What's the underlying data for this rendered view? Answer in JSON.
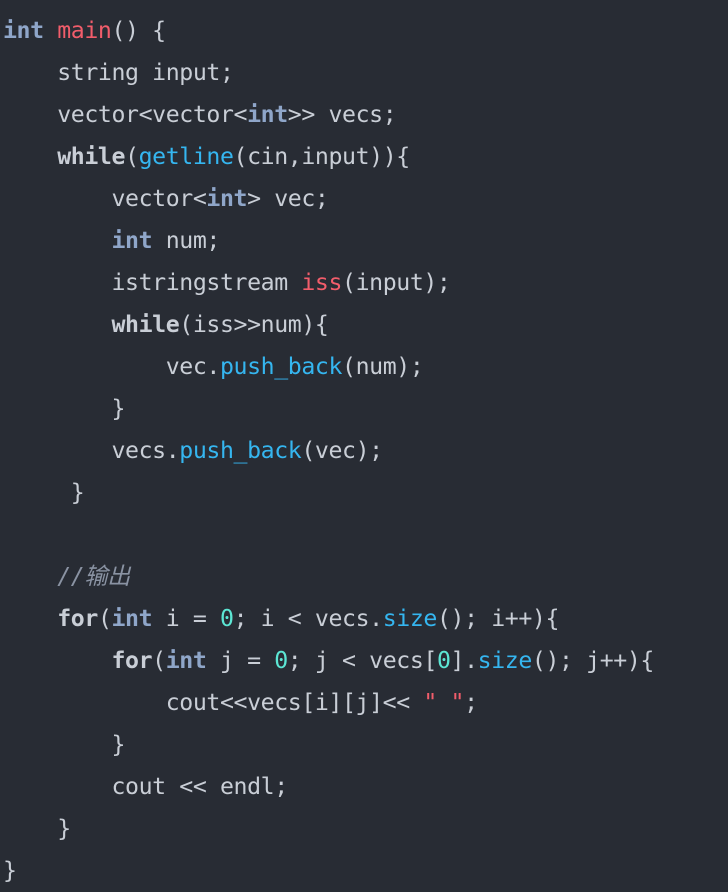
{
  "colors": {
    "background": "#282c34",
    "text": "#c9ced6",
    "type_keyword": "#8fa6c9",
    "function_name": "#f25d6b",
    "function_call": "#35b6f0",
    "number": "#5ce6d4",
    "string": "#f25d6b",
    "comment": "#8a93a3"
  },
  "code": {
    "lines": [
      [
        {
          "t": "int",
          "c": "kw-type"
        },
        {
          "t": " ",
          "c": "plain"
        },
        {
          "t": "main",
          "c": "fn-def"
        },
        {
          "t": "() {",
          "c": "plain"
        }
      ],
      [
        {
          "t": "    string input;",
          "c": "plain"
        }
      ],
      [
        {
          "t": "    vector<vector<",
          "c": "plain"
        },
        {
          "t": "int",
          "c": "kw-type"
        },
        {
          "t": ">> vecs;",
          "c": "plain"
        }
      ],
      [
        {
          "t": "    ",
          "c": "plain"
        },
        {
          "t": "while",
          "c": "kw-ctrl"
        },
        {
          "t": "(",
          "c": "plain"
        },
        {
          "t": "getline",
          "c": "fn-call"
        },
        {
          "t": "(cin,input)){",
          "c": "plain"
        }
      ],
      [
        {
          "t": "        vector<",
          "c": "plain"
        },
        {
          "t": "int",
          "c": "kw-type"
        },
        {
          "t": "> vec;",
          "c": "plain"
        }
      ],
      [
        {
          "t": "        ",
          "c": "plain"
        },
        {
          "t": "int",
          "c": "kw-type"
        },
        {
          "t": " num;",
          "c": "plain"
        }
      ],
      [
        {
          "t": "        istringstream ",
          "c": "plain"
        },
        {
          "t": "iss",
          "c": "fn-def"
        },
        {
          "t": "(input);",
          "c": "plain"
        }
      ],
      [
        {
          "t": "        ",
          "c": "plain"
        },
        {
          "t": "while",
          "c": "kw-ctrl"
        },
        {
          "t": "(iss>>num){",
          "c": "plain"
        }
      ],
      [
        {
          "t": "            vec.",
          "c": "plain"
        },
        {
          "t": "push_back",
          "c": "fn-call"
        },
        {
          "t": "(num);",
          "c": "plain"
        }
      ],
      [
        {
          "t": "        }",
          "c": "plain"
        }
      ],
      [
        {
          "t": "        vecs.",
          "c": "plain"
        },
        {
          "t": "push_back",
          "c": "fn-call"
        },
        {
          "t": "(vec);",
          "c": "plain"
        }
      ],
      [
        {
          "t": "     }",
          "c": "plain"
        }
      ],
      [
        {
          "t": "",
          "c": "plain"
        }
      ],
      [
        {
          "t": "    ",
          "c": "plain"
        },
        {
          "t": "//输出",
          "c": "cmt"
        }
      ],
      [
        {
          "t": "    ",
          "c": "plain"
        },
        {
          "t": "for",
          "c": "kw-ctrl"
        },
        {
          "t": "(",
          "c": "plain"
        },
        {
          "t": "int",
          "c": "kw-type"
        },
        {
          "t": " i = ",
          "c": "plain"
        },
        {
          "t": "0",
          "c": "num"
        },
        {
          "t": "; i < vecs.",
          "c": "plain"
        },
        {
          "t": "size",
          "c": "fn-call"
        },
        {
          "t": "(); i++){",
          "c": "plain"
        }
      ],
      [
        {
          "t": "        ",
          "c": "plain"
        },
        {
          "t": "for",
          "c": "kw-ctrl"
        },
        {
          "t": "(",
          "c": "plain"
        },
        {
          "t": "int",
          "c": "kw-type"
        },
        {
          "t": " j = ",
          "c": "plain"
        },
        {
          "t": "0",
          "c": "num"
        },
        {
          "t": "; j < vecs[",
          "c": "plain"
        },
        {
          "t": "0",
          "c": "num"
        },
        {
          "t": "].",
          "c": "plain"
        },
        {
          "t": "size",
          "c": "fn-call"
        },
        {
          "t": "(); j++){",
          "c": "plain"
        }
      ],
      [
        {
          "t": "            cout<<vecs[i][j]<< ",
          "c": "plain"
        },
        {
          "t": "\" \"",
          "c": "str"
        },
        {
          "t": ";",
          "c": "plain"
        }
      ],
      [
        {
          "t": "        }",
          "c": "plain"
        }
      ],
      [
        {
          "t": "        cout << endl;",
          "c": "plain"
        }
      ],
      [
        {
          "t": "    }",
          "c": "plain"
        }
      ],
      [
        {
          "t": "}",
          "c": "plain"
        }
      ]
    ]
  }
}
